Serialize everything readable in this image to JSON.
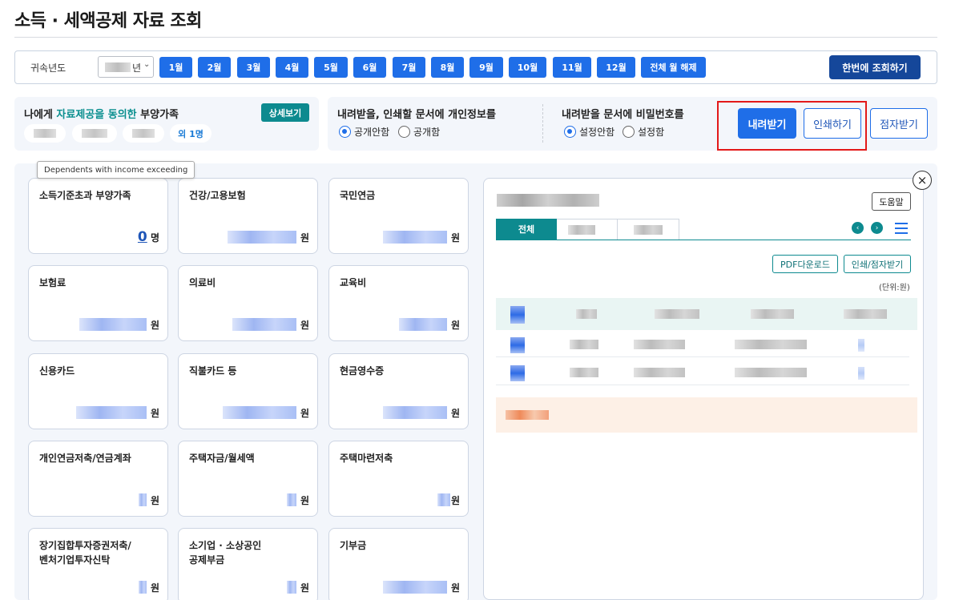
{
  "page": {
    "title": "소득 · 세액공제 자료 조회"
  },
  "month_bar": {
    "year_label": "귀속년도",
    "year_suffix": "년",
    "year_chevron": "⌄",
    "months": [
      "1월",
      "2월",
      "3월",
      "4월",
      "5월",
      "6월",
      "7월",
      "8월",
      "9월",
      "10월",
      "11월",
      "12월"
    ],
    "clear_all": "전체 월 해제",
    "query_all": "한번에 조회하기"
  },
  "dependents": {
    "title_prefix": "나에게 ",
    "title_highlight": "자료제공을 동의한",
    "title_suffix": " 부양가족",
    "detail_button": "상세보기",
    "more": "외 1명"
  },
  "privacy_option": {
    "title": "내려받을, 인쇄할 문서에 개인정보를",
    "options": [
      "공개안함",
      "공개함"
    ],
    "selected": "공개안함"
  },
  "password_option": {
    "title": "내려받을 문서에 비밀번호를",
    "options": [
      "설정안함",
      "설정함"
    ],
    "selected": "설정안함"
  },
  "actions": {
    "download": "내려받기",
    "print": "인쇄하기",
    "braille": "점자받기"
  },
  "tooltip": "Dependents with income exceeding",
  "cards": [
    {
      "label": "소득기준초과 부양가족",
      "value": "0",
      "unit": "명"
    },
    {
      "label": "건강/고용보험",
      "unit": "원"
    },
    {
      "label": "국민연금",
      "unit": "원"
    },
    {
      "label": "보험료",
      "unit": "원"
    },
    {
      "label": "의료비",
      "unit": "원"
    },
    {
      "label": "교육비",
      "unit": "원"
    },
    {
      "label": "신용카드",
      "unit": "원"
    },
    {
      "label": "직불카드 등",
      "unit": "원"
    },
    {
      "label": "현금영수증",
      "unit": "원"
    },
    {
      "label": "개인연금저축/연금계좌",
      "unit": "원"
    },
    {
      "label": "주택자금/월세액",
      "unit": "원"
    },
    {
      "label": "주택마련저축",
      "unit": "원"
    },
    {
      "label": "장기집합투자증권저축/",
      "label2": "벤처기업투자신탁",
      "unit": "원"
    },
    {
      "label": "소기업 · 소상공인",
      "label2": "공제부금",
      "unit": "원"
    },
    {
      "label": "기부금",
      "unit": "원"
    }
  ],
  "detail": {
    "close": "×",
    "help": "도움말",
    "tab_all": "전체",
    "prev": "‹",
    "next": "›",
    "pdf_download": "PDF다운로드",
    "print_braille": "인쇄/점자받기",
    "unit": "(단위:원)"
  }
}
